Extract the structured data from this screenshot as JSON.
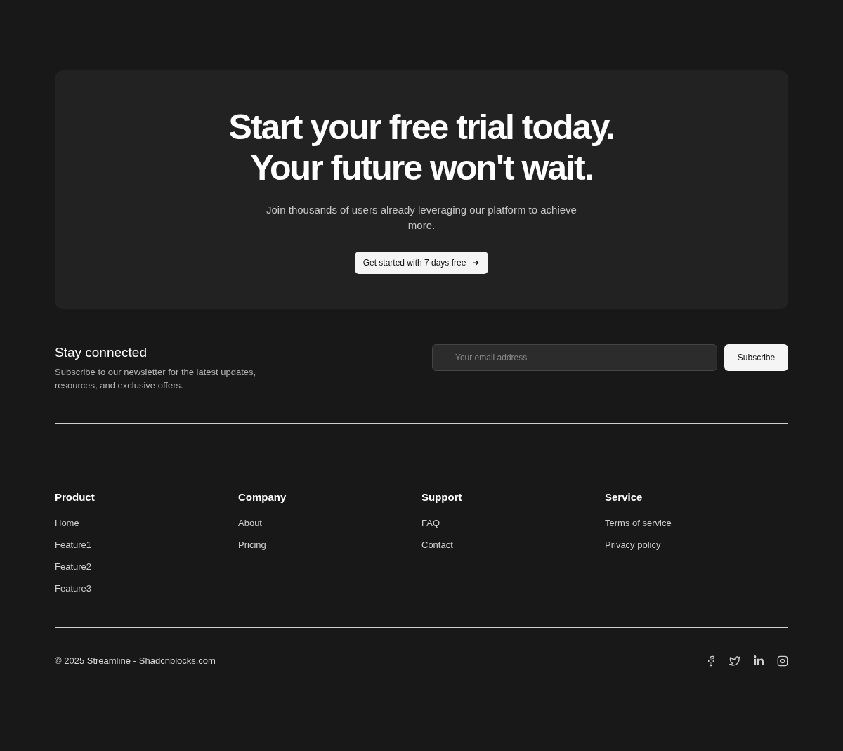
{
  "cta": {
    "title_lines": [
      "Start your free trial today.",
      "Your future won't wait."
    ],
    "subtitle": "Join thousands of users already leveraging our platform to achieve more.",
    "button": "Get started with 7 days free"
  },
  "newsletter": {
    "title": "Stay connected",
    "text": "Subscribe to our newsletter for the latest updates, resources, and exclusive offers.",
    "placeholder": "Your email address",
    "button": "Subscribe"
  },
  "columns": [
    {
      "title": "Product",
      "links": [
        "Home",
        "Feature1",
        "Feature2",
        "Feature3"
      ]
    },
    {
      "title": "Company",
      "links": [
        "About",
        "Pricing"
      ]
    },
    {
      "title": "Support",
      "links": [
        "FAQ",
        "Contact"
      ]
    },
    {
      "title": "Service",
      "links": [
        "Terms of service",
        "Privacy policy"
      ]
    }
  ],
  "footer": {
    "copyright": "© 2025 Streamline -",
    "link": "Shadcnblocks.com",
    "socials": [
      {
        "kind": "facebook"
      },
      {
        "kind": "twitter"
      },
      {
        "kind": "linkedin"
      },
      {
        "kind": "instagram"
      }
    ]
  }
}
